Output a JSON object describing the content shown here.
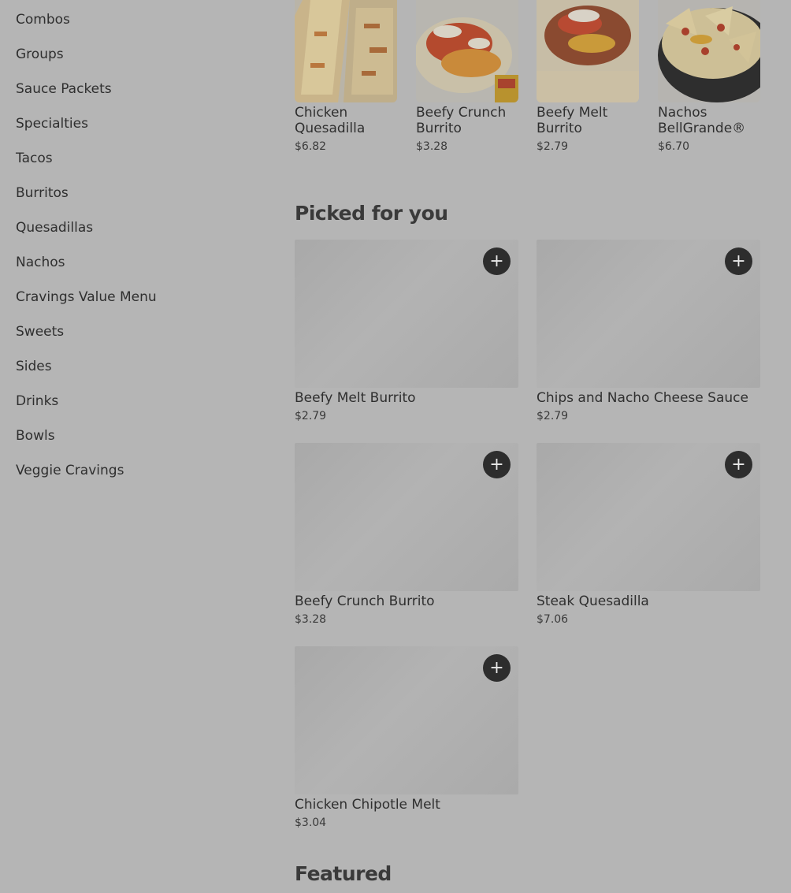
{
  "sidebar": {
    "items": [
      {
        "label": "Combos"
      },
      {
        "label": "Groups"
      },
      {
        "label": "Sauce Packets"
      },
      {
        "label": "Specialties"
      },
      {
        "label": "Tacos"
      },
      {
        "label": "Burritos"
      },
      {
        "label": "Quesadillas"
      },
      {
        "label": "Nachos"
      },
      {
        "label": "Cravings Value Menu"
      },
      {
        "label": "Sweets"
      },
      {
        "label": "Sides"
      },
      {
        "label": "Drinks"
      },
      {
        "label": "Bowls"
      },
      {
        "label": "Veggie Cravings"
      }
    ]
  },
  "top_items": [
    {
      "name": "Chicken Quesadilla",
      "price": "$6.82",
      "image": "chicken-quesadilla-photo"
    },
    {
      "name": "Beefy Crunch Burrito",
      "price": "$3.28",
      "image": "beefy-crunch-burrito-photo"
    },
    {
      "name": "Beefy Melt Burrito",
      "price": "$2.79",
      "image": "beefy-melt-burrito-photo"
    },
    {
      "name": "Nachos BellGrande®",
      "price": "$6.70",
      "image": "nachos-bellgrande-photo"
    }
  ],
  "picked_for_you": {
    "title": "Picked for you",
    "add_icon": "plus-icon",
    "items": [
      {
        "name": "Beefy Melt Burrito",
        "price": "$2.79"
      },
      {
        "name": "Chips and Nacho Cheese Sauce",
        "price": "$2.79"
      },
      {
        "name": "Beefy Crunch Burrito",
        "price": "$3.28"
      },
      {
        "name": "Steak Quesadilla",
        "price": "$7.06"
      },
      {
        "name": "Chicken Chipotle Melt",
        "price": "$3.04"
      }
    ]
  },
  "featured": {
    "title": "Featured"
  },
  "colors": {
    "overlay_background": "#b5b5b5",
    "add_button": "#2d2d2d",
    "text": "#2f2f2f"
  }
}
